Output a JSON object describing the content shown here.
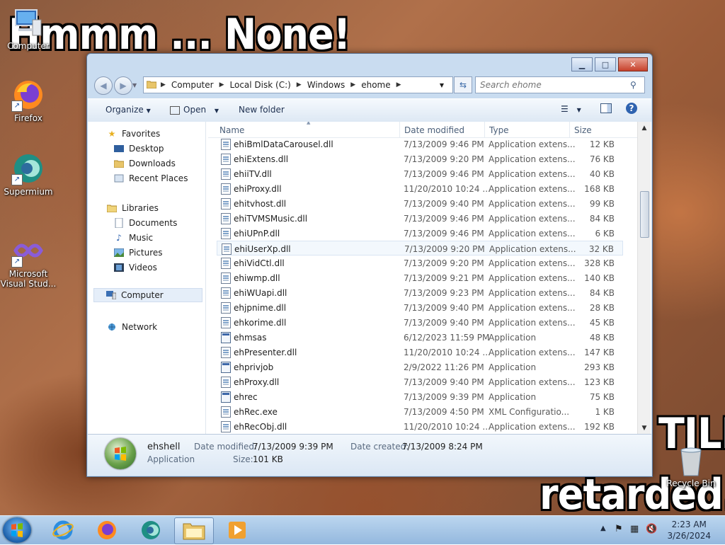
{
  "desktop": {
    "meme_top": "Hmmm ... None!",
    "meme_still": "TILL",
    "meme_bottom": "retarded.",
    "icons": [
      {
        "label": "Computer",
        "icon": "computer-icon"
      },
      {
        "label": "Firefox",
        "icon": "firefox-icon"
      },
      {
        "label": "Supermium",
        "icon": "supermium-icon"
      },
      {
        "label": "Microsoft Visual Stud...",
        "icon": "visual-studio-icon"
      },
      {
        "label": "Recycle Bin",
        "icon": "recycle-bin-icon"
      }
    ]
  },
  "window": {
    "address": {
      "path": [
        "Computer",
        "Local Disk (C:)",
        "Windows",
        "ehome"
      ]
    },
    "search": {
      "placeholder": "Search ehome"
    },
    "toolbar": {
      "organize": "Organize",
      "open": "Open",
      "new_folder": "New folder"
    },
    "nav": {
      "favorites": "Favorites",
      "favorites_items": [
        "Desktop",
        "Downloads",
        "Recent Places"
      ],
      "libraries": "Libraries",
      "libraries_items": [
        "Documents",
        "Music",
        "Pictures",
        "Videos"
      ],
      "computer": "Computer",
      "network": "Network"
    },
    "columns": {
      "name": "Name",
      "date": "Date modified",
      "type": "Type",
      "size": "Size"
    },
    "files": [
      {
        "name": "ehiBmlDataCarousel.dll",
        "date": "7/13/2009 9:46 PM",
        "type": "Application extens...",
        "size": "12 KB",
        "kind": "dll"
      },
      {
        "name": "ehiExtens.dll",
        "date": "7/13/2009 9:20 PM",
        "type": "Application extens...",
        "size": "76 KB",
        "kind": "dll"
      },
      {
        "name": "ehiiTV.dll",
        "date": "7/13/2009 9:46 PM",
        "type": "Application extens...",
        "size": "40 KB",
        "kind": "dll"
      },
      {
        "name": "ehiProxy.dll",
        "date": "11/20/2010 10:24 ...",
        "type": "Application extens...",
        "size": "168 KB",
        "kind": "dll"
      },
      {
        "name": "ehitvhost.dll",
        "date": "7/13/2009 9:40 PM",
        "type": "Application extens...",
        "size": "99 KB",
        "kind": "dll"
      },
      {
        "name": "ehiTVMSMusic.dll",
        "date": "7/13/2009 9:46 PM",
        "type": "Application extens...",
        "size": "84 KB",
        "kind": "dll"
      },
      {
        "name": "ehiUPnP.dll",
        "date": "7/13/2009 9:46 PM",
        "type": "Application extens...",
        "size": "6 KB",
        "kind": "dll"
      },
      {
        "name": "ehiUserXp.dll",
        "date": "7/13/2009 9:20 PM",
        "type": "Application extens...",
        "size": "32 KB",
        "kind": "dll"
      },
      {
        "name": "ehiVidCtl.dll",
        "date": "7/13/2009 9:20 PM",
        "type": "Application extens...",
        "size": "328 KB",
        "kind": "dll"
      },
      {
        "name": "ehiwmp.dll",
        "date": "7/13/2009 9:21 PM",
        "type": "Application extens...",
        "size": "140 KB",
        "kind": "dll"
      },
      {
        "name": "ehiWUapi.dll",
        "date": "7/13/2009 9:23 PM",
        "type": "Application extens...",
        "size": "84 KB",
        "kind": "dll"
      },
      {
        "name": "ehjpnime.dll",
        "date": "7/13/2009 9:40 PM",
        "type": "Application extens...",
        "size": "28 KB",
        "kind": "dll"
      },
      {
        "name": "ehkorime.dll",
        "date": "7/13/2009 9:40 PM",
        "type": "Application extens...",
        "size": "45 KB",
        "kind": "dll"
      },
      {
        "name": "ehmsas",
        "date": "6/12/2023 11:59 PM",
        "type": "Application",
        "size": "48 KB",
        "kind": "app"
      },
      {
        "name": "ehPresenter.dll",
        "date": "11/20/2010 10:24 ...",
        "type": "Application extens...",
        "size": "147 KB",
        "kind": "dll"
      },
      {
        "name": "ehprivjob",
        "date": "2/9/2022 11:26 PM",
        "type": "Application",
        "size": "293 KB",
        "kind": "app"
      },
      {
        "name": "ehProxy.dll",
        "date": "7/13/2009 9:40 PM",
        "type": "Application extens...",
        "size": "123 KB",
        "kind": "dll"
      },
      {
        "name": "ehrec",
        "date": "7/13/2009 9:39 PM",
        "type": "Application",
        "size": "75 KB",
        "kind": "app"
      },
      {
        "name": "ehRec.exe",
        "date": "7/13/2009 4:50 PM",
        "type": "XML Configuratio...",
        "size": "1 KB",
        "kind": "dll"
      },
      {
        "name": "ehRecObj.dll",
        "date": "11/20/2010 10:24 ...",
        "type": "Application extens...",
        "size": "192 KB",
        "kind": "dll"
      }
    ],
    "details": {
      "name": "ehshell",
      "type": "Application",
      "date_modified_label": "Date modified:",
      "date_modified": "7/13/2009 9:39 PM",
      "date_created_label": "Date created:",
      "date_created": "7/13/2009 8:24 PM",
      "size_label": "Size:",
      "size": "101 KB"
    }
  },
  "taskbar": {
    "items": [
      "start-orb",
      "internet-explorer-icon",
      "firefox-icon",
      "supermium-icon",
      "explorer-icon",
      "media-player-icon"
    ],
    "time": "2:23 AM",
    "date": "3/26/2024"
  }
}
